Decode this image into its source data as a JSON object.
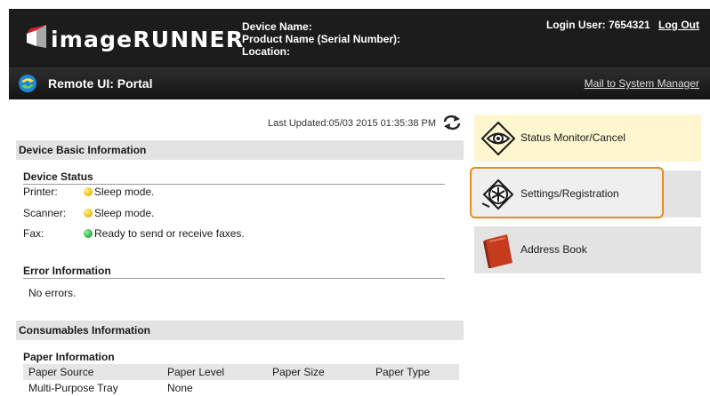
{
  "header": {
    "logo_text": "imageRUNNER",
    "device_name_label": "Device Name:",
    "product_name_label": "Product Name (Serial Number):",
    "location_label": "Location:",
    "login_user_label": "Login User:",
    "login_user_id": "7654321",
    "logout_label": "Log Out"
  },
  "portal": {
    "title": "Remote UI: Portal",
    "mail_link": "Mail to System Manager"
  },
  "main": {
    "last_updated": "Last Updated:05/03 2015 01:35:38 PM",
    "device_basic": {
      "title": "Device Basic Information",
      "status_title": "Device Status",
      "rows": [
        {
          "label": "Printer:",
          "status": "Sleep mode.",
          "color": "#e8b800"
        },
        {
          "label": "Scanner:",
          "status": "Sleep mode.",
          "color": "#e8b800"
        },
        {
          "label": "Fax:",
          "status": "Ready to send or receive faxes.",
          "color": "#1db13b"
        }
      ]
    },
    "error": {
      "title": "Error Information",
      "text": "No errors."
    },
    "consumables": {
      "title": "Consumables Information",
      "paper_title": "Paper Information",
      "columns": [
        "Paper Source",
        "Paper Level",
        "Paper Size",
        "Paper Type"
      ],
      "rows": [
        [
          "Multi-Purpose Tray",
          "None",
          "",
          ""
        ]
      ]
    }
  },
  "menu": {
    "status_monitor": {
      "label": "Status Monitor/Cancel",
      "icon": "eye-icon"
    },
    "settings": {
      "label": "Settings/Registration",
      "icon": "gear-asterisk-icon"
    },
    "address_book": {
      "label": "Address Book",
      "icon": "book-icon"
    }
  },
  "colors": {
    "header_bg": "#1c1c1c",
    "status_card_bg": "#fdf6cf",
    "focus_ring": "#e88b1f",
    "section_bg": "#e3e3e3"
  }
}
